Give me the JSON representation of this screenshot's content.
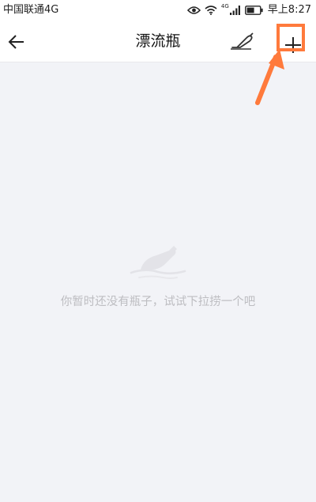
{
  "status_bar": {
    "carrier": "中国联通4G",
    "network_tag": "4G",
    "time": "早上8:27"
  },
  "nav": {
    "title": "漂流瓶"
  },
  "empty_state": {
    "message": "你暂时还没有瓶子，试试下拉捞一个吧"
  },
  "colors": {
    "annotation": "#ff7a3c",
    "background": "#f2f3f7",
    "empty_text": "#bdbdc1"
  },
  "icons": {
    "back": "arrow-left-icon",
    "throw_bottle": "bottle-throw-icon",
    "add": "plus-icon",
    "empty": "bottle-empty-icon"
  }
}
